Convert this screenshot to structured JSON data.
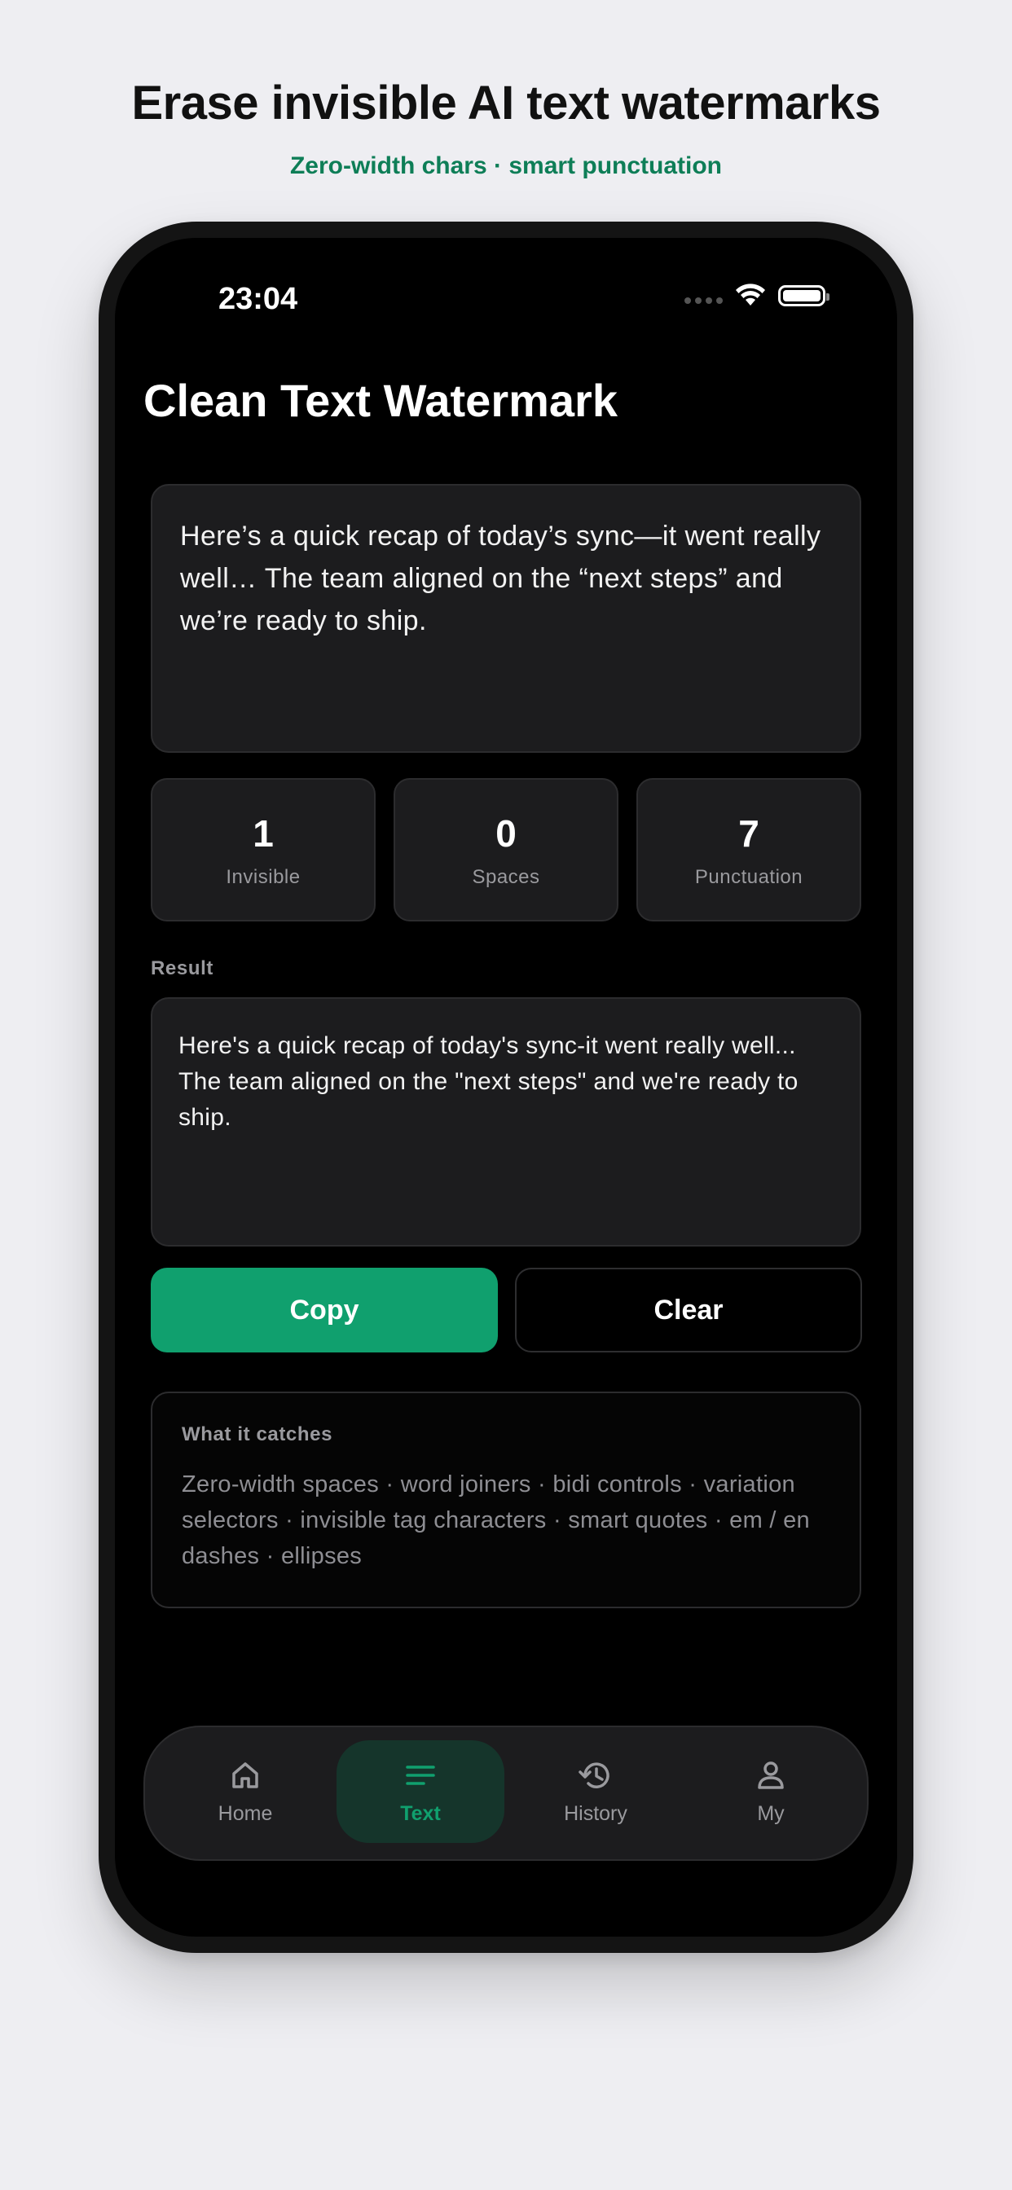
{
  "promo": {
    "headline": "Erase invisible AI text watermarks",
    "subhead": "Zero-width chars · smart punctuation"
  },
  "status_bar": {
    "time": "23:04"
  },
  "app": {
    "title": "Clean Text Watermark"
  },
  "input": {
    "text": "Here’s a quick recap of today’s sync—it went really well… The team aligned on the “next steps” and we’re ready to ship."
  },
  "stats": [
    {
      "value": "1",
      "label": "Invisible"
    },
    {
      "value": "0",
      "label": "Spaces"
    },
    {
      "value": "7",
      "label": "Punctuation"
    }
  ],
  "result": {
    "label": "Result",
    "text": "Here's a quick recap of today's sync-it went really well... The team aligned on the \"next steps\" and we're ready to ship."
  },
  "actions": {
    "copy_label": "Copy",
    "clear_label": "Clear"
  },
  "info": {
    "title": "What it catches",
    "body": "Zero-width spaces · word joiners · bidi controls · variation selectors · invisible tag characters · smart quotes · em / en dashes · ellipses"
  },
  "tabbar": {
    "items": [
      {
        "label": "Home",
        "icon": "home-icon",
        "active": false
      },
      {
        "label": "Text",
        "icon": "text-lines-icon",
        "active": true
      },
      {
        "label": "History",
        "icon": "history-icon",
        "active": false
      },
      {
        "label": "My",
        "icon": "person-icon",
        "active": false
      }
    ]
  },
  "colors": {
    "accent": "#10a06e",
    "accent_text": "#0e7e57",
    "background": "#eeeef2",
    "screen": "#000000",
    "card": "#1c1c1e"
  }
}
